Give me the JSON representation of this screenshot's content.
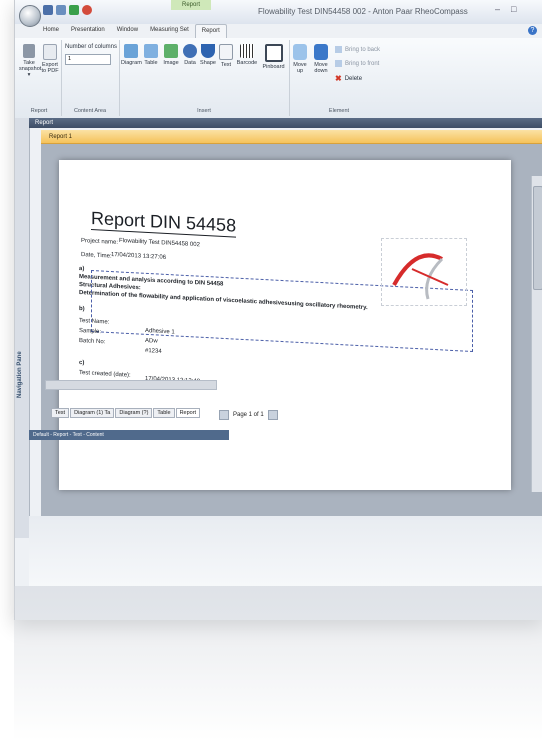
{
  "window": {
    "title": "Flowability Test DIN54458 002 - Anton Paar RheoCompass",
    "context_tab_group": "Report",
    "controls": {
      "minimize": "–",
      "maximize": "□"
    }
  },
  "tabs": [
    "Home",
    "Presentation",
    "Window",
    "Measuring Set",
    "Report"
  ],
  "ribbon": {
    "report_group": {
      "label": "Report",
      "take_snapshot": "Take snapshot ▾",
      "export": "Export to PDF"
    },
    "content_area_group": {
      "label": "Content Area",
      "columns_label": "Number of columns",
      "columns_value": "1"
    },
    "insert_group": {
      "label": "Insert",
      "items": [
        "Diagram",
        "Table",
        "Image",
        "Data",
        "Shape",
        "Text",
        "Barcode",
        "Pinboard"
      ]
    },
    "element_group": {
      "label": "Element",
      "move_up": "Move up",
      "move_down": "Move down",
      "bring_back": "Bring to back",
      "bring_front": "Bring to front",
      "delete": "Delete"
    }
  },
  "panes": {
    "report_bar": "Report",
    "doc_tab": "Report 1",
    "navigation": "Navigation Pane"
  },
  "report": {
    "title": "Report DIN 54458",
    "project_label": "Project name:",
    "project_value": "Flowability Test DIN54458 002",
    "date_label": "Date, Time:",
    "date_value": "17/04/2013 13:27:06",
    "section_a": "a)",
    "line1": "Measurement and analysis according to DIN 54458",
    "line2": "Structural Adhesives:",
    "line3": "Determination of the flowability and application of viscoelastic adhesivesusing oscillatory rheometry.",
    "section_b": "b)",
    "test_name_label": "Test Name:",
    "sample_label": "Sample:",
    "sample_value": "Adhesive 1",
    "batch_label": "Batch No:",
    "batch_value": "ADw",
    "batch_value2": "#1234",
    "section_c": "c)",
    "created_label": "Test created (date):",
    "created_value": "17/04/2013 12:12:48"
  },
  "bottom_tabs": [
    "Test",
    "Diagram (1) Ta",
    "Diagram (?)",
    "Table",
    "Report"
  ],
  "pager": {
    "text": "Page 1 of 1"
  },
  "status": "Default - Report - Text - Content",
  "colors": {
    "accent": "#f5c25a",
    "ribbon_bg": "#e3e9f0",
    "report_bar": "#3e4d66"
  }
}
